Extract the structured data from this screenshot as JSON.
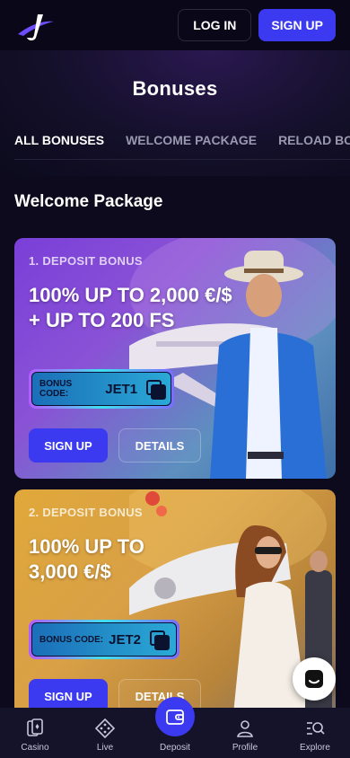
{
  "header": {
    "login_label": "LOG IN",
    "signup_label": "SIGN UP"
  },
  "page": {
    "title": "Bonuses"
  },
  "tabs": [
    {
      "label": "ALL BONUSES",
      "active": true
    },
    {
      "label": "WELCOME PACKAGE",
      "active": false
    },
    {
      "label": "RELOAD BON",
      "active": false
    }
  ],
  "section": {
    "title": "Welcome Package"
  },
  "bonuses": [
    {
      "label": "1. DEPOSIT BONUS",
      "headline_line1": "100% UP TO 2,000 €/$",
      "headline_line2": "+ UP TO 200 FS",
      "code_label": "BONUS CODE:",
      "code": "JET1",
      "signup_label": "SIGN UP",
      "details_label": "DETAILS"
    },
    {
      "label": "2. DEPOSIT BONUS",
      "headline_line1": "100% UP TO",
      "headline_line2": "3,000 €/$",
      "code_label": "BONUS CODE:",
      "code": "JET2",
      "signup_label": "SIGN UP",
      "details_label": "DETAILS"
    }
  ],
  "bottom_nav": [
    {
      "label": "Casino",
      "icon": "cards-icon"
    },
    {
      "label": "Live",
      "icon": "chip-icon"
    },
    {
      "label": "Deposit",
      "icon": "wallet-icon"
    },
    {
      "label": "Profile",
      "icon": "user-icon"
    },
    {
      "label": "Explore",
      "icon": "search-icon"
    }
  ],
  "colors": {
    "background": "#0c0a1c",
    "accent": "#3b3af0"
  }
}
